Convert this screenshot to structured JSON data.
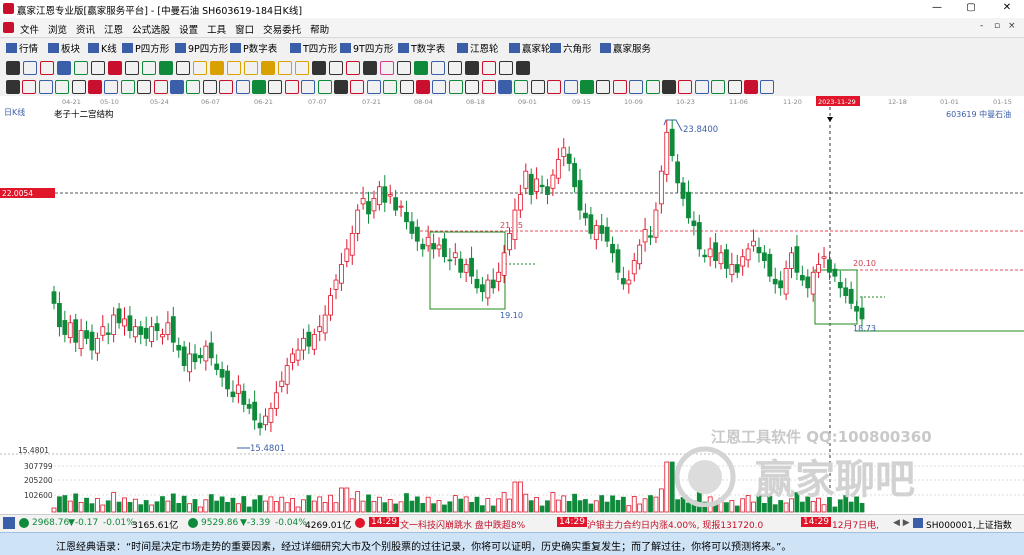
{
  "window": {
    "title": "赢家江恩专业版[赢家服务平台] - [中曼石油  SH603619-184日K线]",
    "minimize": "—",
    "restore": "▢",
    "close": "✕"
  },
  "menu": {
    "items": [
      "文件",
      "浏览",
      "资讯",
      "江恩",
      "公式选股",
      "设置",
      "工具",
      "窗口",
      "交易委托",
      "帮助"
    ],
    "right_minus": "-",
    "right_restore": "▫",
    "right_close": "×"
  },
  "toolbar": {
    "items": [
      "行情",
      "板块",
      "K线",
      "P四方形",
      "9P四方形",
      "P数字表",
      "T四方形",
      "9T四方形",
      "T数字表",
      "江恩轮",
      "赢家轮",
      "六角形",
      "赢家服务"
    ]
  },
  "chart": {
    "period_label": "日K线",
    "indicator_label": "老子十二宫结构",
    "stock": "603619  中曼石油",
    "date_labels": [
      "04-21",
      "05-10",
      "05-24",
      "06-07",
      "06-21",
      "07-07",
      "07-21",
      "08-04",
      "08-18",
      "09-01",
      "09-15",
      "10-09",
      "10-23",
      "11-06",
      "11-20",
      "2023-11-29",
      "12-18",
      "01-01",
      "01-15"
    ],
    "cursor_date": "2023-11-29",
    "cursor_price": "22.0054",
    "price_high_label": "23.8400",
    "price_low_label": "15.4801",
    "box1_top": "21.05",
    "box1_bottom": "19.10",
    "box2_top": "20.10",
    "box2_bottom": "18.73",
    "bottom_axis_price": "15.4801",
    "volume_ticks": [
      "307799",
      "205200",
      "102600"
    ],
    "colors": {
      "up": "#e0152a",
      "down": "#0e8a3a",
      "box": "#1f8a1f",
      "cursor": "#333333",
      "redline": "#e44d5c"
    }
  },
  "chart_data": {
    "type": "candlestick",
    "title": "老子十二宫结构",
    "x_range": [
      "04-21",
      "01-15"
    ],
    "price_range": [
      15.4801,
      23.84
    ],
    "annotations": [
      {
        "label": "23.8400",
        "kind": "high"
      },
      {
        "label": "15.4801",
        "kind": "low"
      },
      {
        "label": "21.05",
        "kind": "box-top"
      },
      {
        "label": "19.10",
        "kind": "box-bottom"
      },
      {
        "label": "20.10",
        "kind": "box-top"
      },
      {
        "label": "18.73",
        "kind": "box-bottom"
      }
    ],
    "volume_ticks": [
      307799,
      205200,
      102600
    ]
  },
  "status": {
    "sh_index": "2968.76",
    "sh_change": "▼-0.17",
    "sh_pct": "-0.01%",
    "sh_amount": "3165.61亿",
    "sz_index": "9529.86",
    "sz_change": "▼-3.39",
    "sz_pct": "-0.04%",
    "sz_amount": "4269.01亿",
    "news1_time": "14:29",
    "news1": "文一科技闪崩跳水 盘中跌超8%",
    "news2_time": "14:29",
    "news2": "沪银主力合约日内涨4.00%, 现报131720.0",
    "news3_time": "14:29",
    "news3": "12月7日电,",
    "code": "SH000001,上证指数"
  },
  "quote": "江恩经典语录：“时间是决定市场走势的重要因素，经过详细研究大市及个别股票的过往记录，你将可以证明，历史确实重复发生；而了解过往，你将可以预测将来。”。",
  "watermark": {
    "line1": "江恩工具软件  QQ:100800360",
    "line2": "赢家聊吧"
  }
}
